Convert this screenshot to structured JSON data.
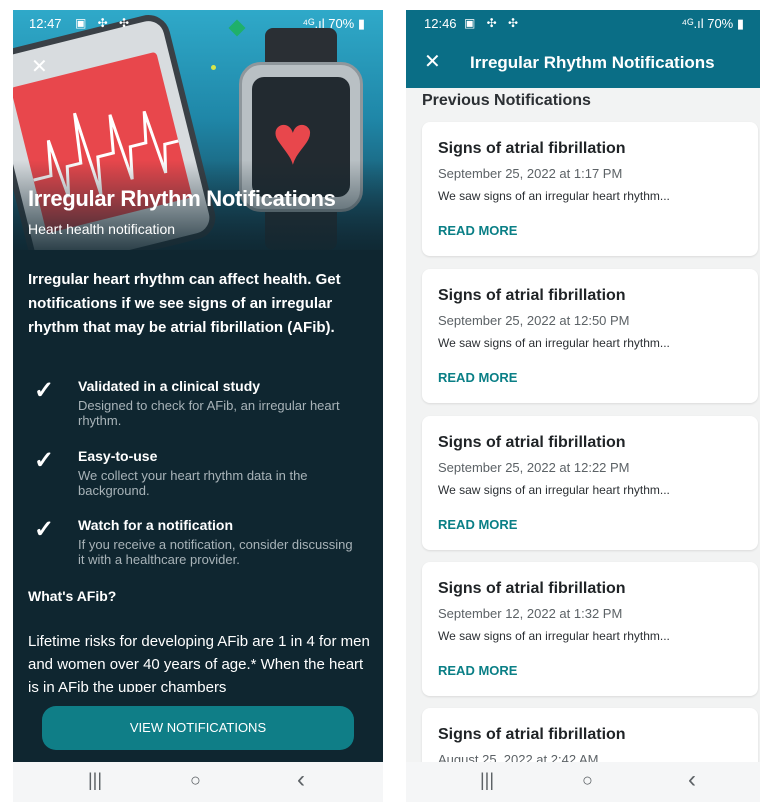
{
  "left": {
    "status": {
      "time": "12:47",
      "icons": "▣ ✣ ✣",
      "right": "⁴ᴳ.ıl 70% ▮"
    },
    "close_icon": "✕",
    "hero_title": "Irregular Rhythm Notifications",
    "hero_subtitle": "Heart health notification",
    "intro": "Irregular heart rhythm can affect health. Get notifications if we see signs of an irregular rhythm that may be atrial fibrillation (AFib).",
    "features": [
      {
        "icon": "checkmark-icon",
        "title": "Validated in a clinical study",
        "desc": "Designed to check for AFib, an irregular heart rhythm."
      },
      {
        "icon": "checkmark-icon",
        "title": "Easy-to-use",
        "desc": "We collect your heart rhythm data in the background."
      },
      {
        "icon": "checkmark-icon",
        "title": "Watch for a notification",
        "desc": "If you receive a notification, consider discussing it with a healthcare provider."
      }
    ],
    "afib_heading": "What's AFib?",
    "afib_text": "Lifetime risks for developing AFib are 1 in 4 for men and women over 40 years of age.* When the heart is in AFib the upper chambers",
    "view_button": "VIEW NOTIFICATIONS",
    "nav": {
      "recents": "|||",
      "home": "○",
      "back": "‹"
    }
  },
  "right": {
    "status": {
      "time": "12:46",
      "icons": "▣ ✣ ✣",
      "right": "⁴ᴳ.ıl 70% ▮"
    },
    "close_icon": "✕",
    "header_title": "Irregular Rhythm Notifications",
    "section_title": "Previous Notifications",
    "notifications": [
      {
        "title": "Signs of atrial fibrillation",
        "date": "September 25, 2022 at 1:17 PM",
        "body": "We saw signs of an irregular heart rhythm...",
        "action": "READ MORE"
      },
      {
        "title": "Signs of atrial fibrillation",
        "date": "September 25, 2022 at 12:50 PM",
        "body": "We saw signs of an irregular heart rhythm...",
        "action": "READ MORE"
      },
      {
        "title": "Signs of atrial fibrillation",
        "date": "September 25, 2022 at 12:22 PM",
        "body": "We saw signs of an irregular heart rhythm...",
        "action": "READ MORE"
      },
      {
        "title": "Signs of atrial fibrillation",
        "date": "September 12, 2022 at 1:32 PM",
        "body": "We saw signs of an irregular heart rhythm...",
        "action": "READ MORE"
      },
      {
        "title": "Signs of atrial fibrillation",
        "date": "August 25, 2022 at 2:42 AM",
        "body": "",
        "action": ""
      }
    ],
    "nav": {
      "recents": "|||",
      "home": "○",
      "back": "‹"
    }
  },
  "colors": {
    "teal": "#0a6e86",
    "button": "#0f7e87",
    "dark_bg": "#0f2630",
    "heart": "#e8474c",
    "link": "#0a7f86"
  }
}
